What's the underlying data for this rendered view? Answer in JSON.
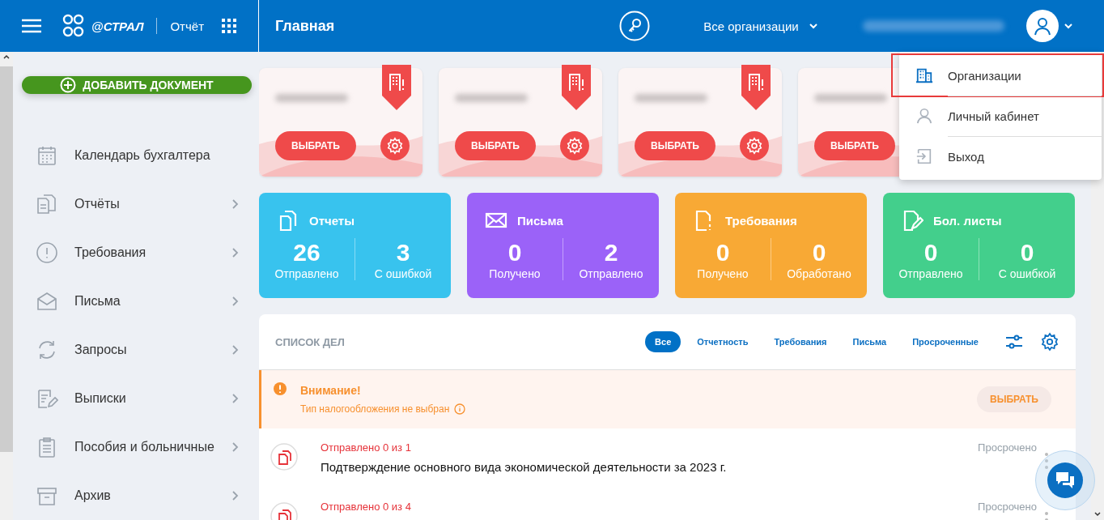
{
  "header": {
    "logo_text": "@СТРАЛ",
    "app_name": "Отчёт",
    "page_title": "Главная",
    "org_selector": "Все организации"
  },
  "user_menu": [
    {
      "label": "Организации",
      "kind": "building",
      "highlighted": true
    },
    {
      "label": "Личный кабинет",
      "kind": "person",
      "highlighted": false
    },
    {
      "label": "Выход",
      "kind": "exit",
      "highlighted": false
    }
  ],
  "sidebar": {
    "add_button": "ДОБАВИТЬ ДОКУМЕНТ",
    "items": [
      {
        "label": "Календарь бухгалтера",
        "kind": "calendar",
        "has_submenu": false
      },
      {
        "label": "Отчёты",
        "kind": "reports",
        "has_submenu": true
      },
      {
        "label": "Требования",
        "kind": "alert",
        "has_submenu": true
      },
      {
        "label": "Письма",
        "kind": "mail",
        "has_submenu": true
      },
      {
        "label": "Запросы",
        "kind": "sync",
        "has_submenu": true
      },
      {
        "label": "Выписки",
        "kind": "edit",
        "has_submenu": true
      },
      {
        "label": "Пособия и больничные",
        "kind": "clipboard",
        "has_submenu": true
      },
      {
        "label": "Архив",
        "kind": "archive",
        "has_submenu": true
      }
    ]
  },
  "org_cards": [
    {
      "button": "ВЫБРАТЬ"
    },
    {
      "button": "ВЫБРАТЬ"
    },
    {
      "button": "ВЫБРАТЬ"
    },
    {
      "button": "ВЫБРАТЬ"
    }
  ],
  "stat_tiles": [
    {
      "title": "Отчеты",
      "kind": "reports",
      "color": "#38c3ee",
      "stats": [
        {
          "value": "26",
          "label": "Отправлено"
        },
        {
          "value": "3",
          "label": "С ошибкой"
        }
      ]
    },
    {
      "title": "Письма",
      "kind": "mail",
      "color": "#9b62f8",
      "stats": [
        {
          "value": "0",
          "label": "Получено"
        },
        {
          "value": "2",
          "label": "Отправлено"
        }
      ]
    },
    {
      "title": "Требования",
      "kind": "demand",
      "color": "#f8a935",
      "stats": [
        {
          "value": "0",
          "label": "Получено"
        },
        {
          "value": "0",
          "label": "Обработано"
        }
      ]
    },
    {
      "title": "Бол. листы",
      "kind": "sick",
      "color": "#43cf8c",
      "stats": [
        {
          "value": "0",
          "label": "Отправлено"
        },
        {
          "value": "0",
          "label": "С ошибкой"
        }
      ]
    }
  ],
  "task_list": {
    "title": "СПИСОК ДЕЛ",
    "filters": [
      {
        "label": "Все",
        "selected": true
      },
      {
        "label": "Отчетность",
        "selected": false
      },
      {
        "label": "Требования",
        "selected": false
      },
      {
        "label": "Письма",
        "selected": false
      },
      {
        "label": "Просроченные",
        "selected": false
      }
    ],
    "warning": {
      "title": "Внимание!",
      "text": "Тип налогообложения не выбран",
      "button": "ВЫБРАТЬ"
    },
    "tasks": [
      {
        "progress": "Отправлено 0 из 1",
        "overdue": true,
        "title": "Подтверждение основного вида экономической деятельности за 2023 г.",
        "status": "Просрочено"
      },
      {
        "progress": "Отправлено 0 из 4",
        "overdue": true,
        "status": "Просрочено"
      }
    ]
  }
}
